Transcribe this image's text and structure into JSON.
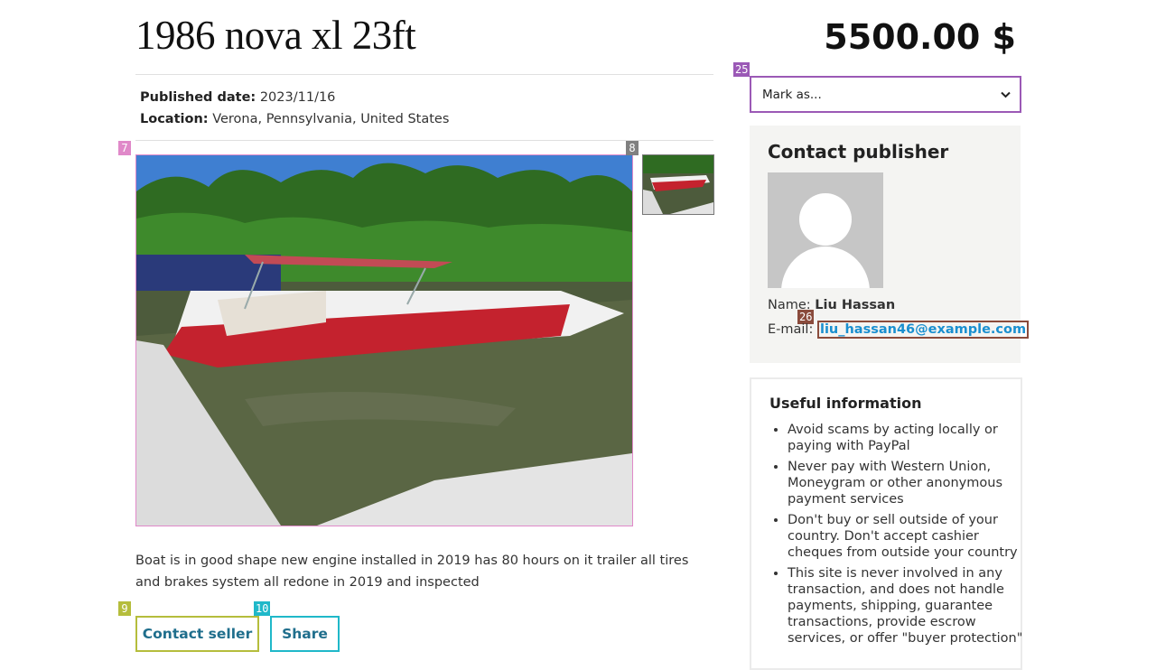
{
  "listing": {
    "title": "1986 nova xl 23ft",
    "price": "5500.00 $",
    "published_label": "Published date:",
    "published_value": "2023/11/16",
    "location_label": "Location:",
    "location_value": "Verona, Pennsylvania, United States",
    "description": "Boat is in good shape new engine installed in 2019 has 80 hours on it trailer all tires and brakes system all redone in 2019 and inspected"
  },
  "actions": {
    "contact_seller": "Contact seller",
    "share": "Share"
  },
  "mark_as": {
    "selected": "Mark as..."
  },
  "contact": {
    "heading": "Contact publisher",
    "name_label": "Name:",
    "name_value": "Liu Hassan",
    "email_label": "E-mail:",
    "email_value": "liu_hassan46@example.com"
  },
  "useful_info": {
    "heading": "Useful information",
    "items": [
      "Avoid scams by acting locally or paying with PayPal",
      "Never pay with Western Union, Moneygram or other anonymous payment services",
      "Don't buy or sell outside of your country. Don't accept cashier cheques from outside your country",
      "This site is never involved in any transaction, and does not handle payments, shipping, guarantee transactions, provide escrow services, or offer \"buyer protection\""
    ]
  },
  "marks": {
    "m7": "7",
    "m8": "8",
    "m9": "9",
    "m10": "10",
    "m25": "25",
    "m26": "26"
  },
  "colors": {
    "mark7": "#e089c9",
    "mark8": "#808080",
    "mark9": "#b5bd3c",
    "mark10": "#1fb8c9",
    "mark25": "#9b59b6",
    "mark26": "#8a4b3c",
    "link": "#1a8fd0",
    "button_text": "#1f6e8c"
  }
}
